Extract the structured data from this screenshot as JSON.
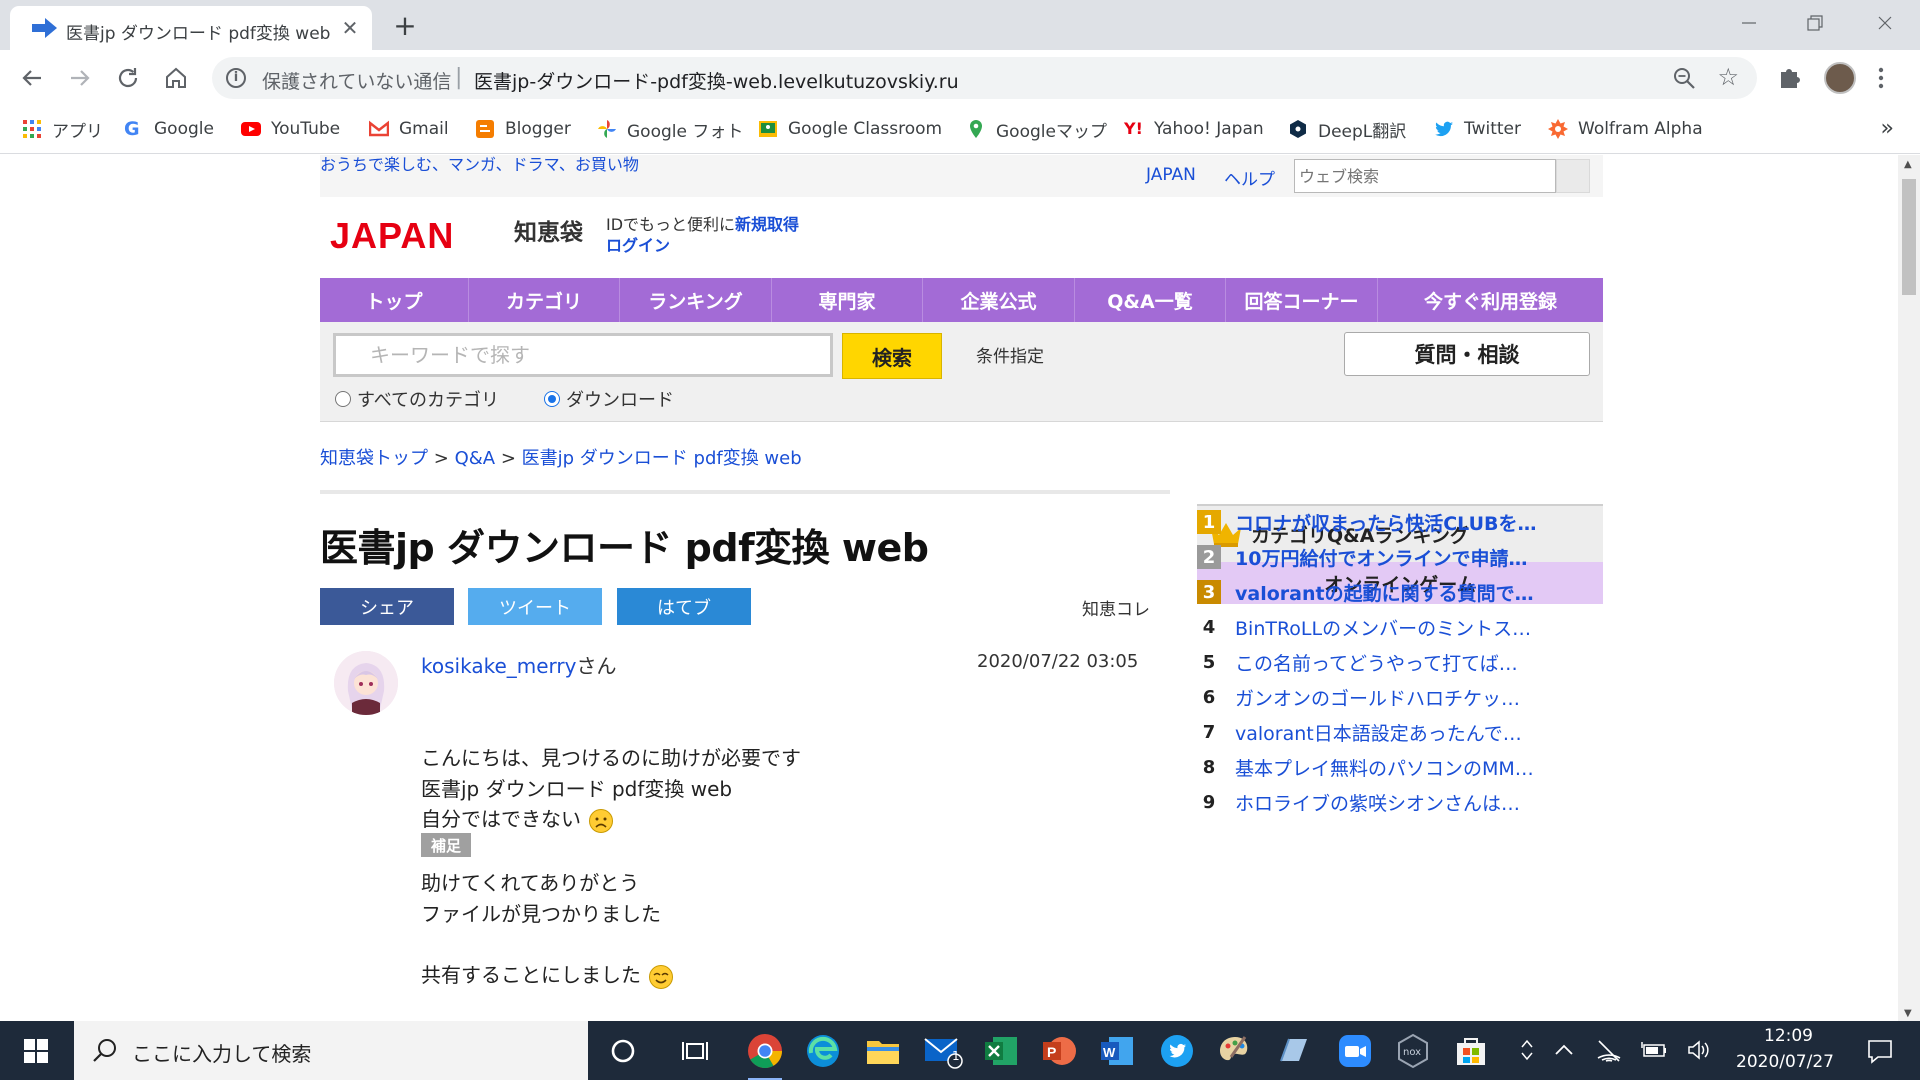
{
  "browser": {
    "tab": {
      "title": "医書jp ダウンロード pdf変換 web",
      "close_glyph": "✕"
    },
    "new_tab_glyph": "+",
    "window_controls": [
      "minimize",
      "restore",
      "close"
    ],
    "omnibox": {
      "security_label": "保護されていない通信",
      "separator": "|",
      "url": "医書jp-ダウンロード-pdf変換-web.levelkutuzovskiy.ru"
    },
    "bookmarks": [
      {
        "label": "アプリ",
        "icon": "apps-grid-icon"
      },
      {
        "label": "Google",
        "icon": "google-icon"
      },
      {
        "label": "YouTube",
        "icon": "youtube-icon"
      },
      {
        "label": "Gmail",
        "icon": "gmail-icon"
      },
      {
        "label": "Blogger",
        "icon": "blogger-icon"
      },
      {
        "label": "Google フォト",
        "icon": "google-photos-icon"
      },
      {
        "label": "Google Classroom",
        "icon": "google-classroom-icon"
      },
      {
        "label": "Googleマップ",
        "icon": "google-maps-icon"
      },
      {
        "label": "Yahoo! Japan",
        "icon": "yahoo-icon"
      },
      {
        "label": "DeepL翻訳",
        "icon": "deepl-icon"
      },
      {
        "label": "Twitter",
        "icon": "twitter-icon"
      },
      {
        "label": "Wolfram Alpha",
        "icon": "wolfram-icon"
      }
    ],
    "bookmarks_more": "»"
  },
  "site": {
    "tagline": "おうちで楽しむ、マンガ、ドラマ、お買い物",
    "top_links": {
      "japan": "JAPAN",
      "help": "ヘルプ"
    },
    "web_search_placeholder": "ウェブ検索",
    "logo": "JAPAN",
    "service_name": "知恵袋",
    "id_text": "IDでもっと便利に",
    "id_signup": "新規取得",
    "login": "ログイン",
    "nav": [
      "トップ",
      "カテゴリ",
      "ランキング",
      "専門家",
      "企業公式",
      "Q&A一覧",
      "回答コーナー",
      "今すぐ利用登録"
    ],
    "search": {
      "placeholder": "キーワードで探す",
      "button": "検索",
      "conditions": "条件指定",
      "ask_button": "質問・相談",
      "radio_all": "すべてのカテゴリ",
      "radio_download": "ダウンロード",
      "selected": "ダウンロード"
    },
    "breadcrumb": {
      "home": "知恵袋トップ",
      "sep": ">",
      "qa": "Q&A",
      "current": "医書jp ダウンロード pdf変換 web"
    },
    "accent_color": "#a36bd6"
  },
  "question": {
    "title": "医書jp ダウンロード pdf変換 web",
    "share": {
      "facebook": "シェア",
      "twitter": "ツイート",
      "hatena": "はてブ"
    },
    "chiekore": "知恵コレ",
    "user": "kosikake_merry",
    "user_suffix": "さん",
    "date": "2020/07/22 03:05",
    "body": [
      "こんにちは、見つけるのに助けが必要です",
      "医書jp ダウンロード pdf変換 web",
      "自分ではできない"
    ],
    "supplement_label": "補足",
    "supplement": [
      "助けてくれてありがとう",
      "ファイルが見つかりました",
      "共有することにしました"
    ]
  },
  "ranking": {
    "title": "カテゴリQ&Aランキング",
    "category": "オンラインゲーム",
    "items": [
      {
        "rank": "1",
        "text": "コロナが収まったら快活CLUBを…"
      },
      {
        "rank": "2",
        "text": "10万円給付でオンラインで申請…"
      },
      {
        "rank": "3",
        "text": "valorantの起動に関する質問で…"
      },
      {
        "rank": "4",
        "text": "BinTRoLLのメンバーのミントス…"
      },
      {
        "rank": "5",
        "text": "この名前ってどうやって打てば…"
      },
      {
        "rank": "6",
        "text": "ガンオンのゴールドハロチケッ…"
      },
      {
        "rank": "7",
        "text": "valorant日本語設定あったんで…"
      },
      {
        "rank": "8",
        "text": "基本プレイ無料のパソコンのMM…"
      },
      {
        "rank": "9",
        "text": "ホロライブの紫咲シオンさんは…"
      }
    ]
  },
  "taskbar": {
    "search_placeholder": "ここに入力して検索",
    "time": "12:09",
    "date": "2020/07/27",
    "mail_badge": "1"
  }
}
